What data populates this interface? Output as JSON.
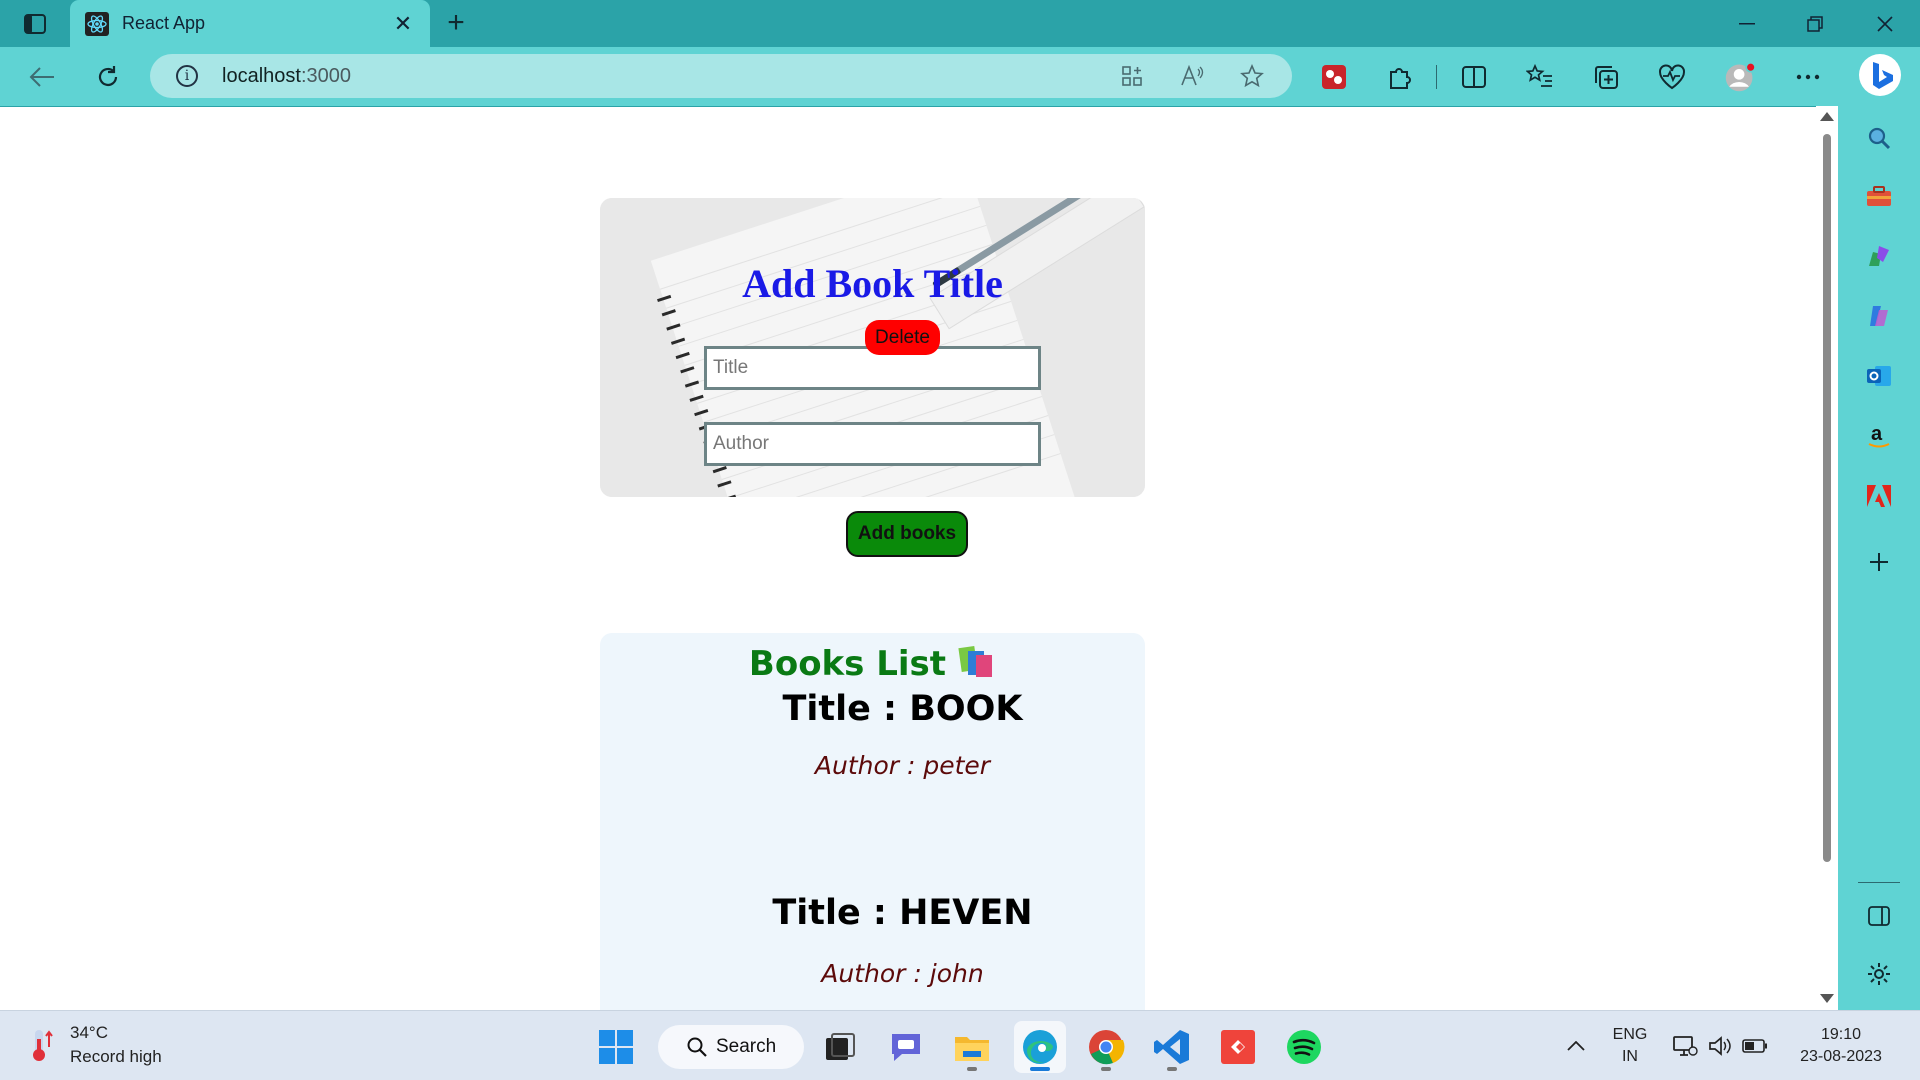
{
  "browser": {
    "tab_title": "React App",
    "url_host": "localhost",
    "url_port": ":3000"
  },
  "form": {
    "heading": "Add Book Title",
    "title_placeholder": "Title",
    "author_placeholder": "Author",
    "add_button": "Add books"
  },
  "books": {
    "heading": "Books List",
    "items": [
      {
        "title": "Title : BOOK",
        "author": "Author : peter",
        "delete_label": "Delete"
      },
      {
        "title": "Title : HEVEN",
        "author": "Author : john"
      }
    ]
  },
  "taskbar": {
    "weather_temp": "34°C",
    "weather_desc": "Record high",
    "search_label": "Search",
    "lang_top": "ENG",
    "lang_bottom": "IN",
    "time": "19:10",
    "date": "23-08-2023"
  },
  "colors": {
    "tabstrip": "#2ba3a8",
    "toolbar": "#5fd3d3",
    "form_heading": "#1a1ae6",
    "add_button": "#0a8a0a",
    "list_heading": "#0a7a14",
    "delete_button": "#ff0000"
  }
}
